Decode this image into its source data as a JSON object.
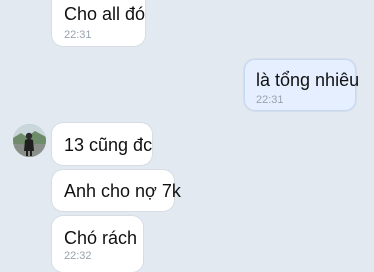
{
  "messages": [
    {
      "side": "incoming",
      "text": "Cho all đó",
      "time": "22:31"
    },
    {
      "side": "outgoing",
      "text": "là tổng nhiêu",
      "time": "22:31"
    },
    {
      "side": "incoming",
      "text": "13 cũng đc",
      "time": ""
    },
    {
      "side": "incoming",
      "text": "Anh cho nợ 7k",
      "time": ""
    },
    {
      "side": "incoming",
      "text": "Chó rách",
      "time": "22:32"
    }
  ],
  "avatar": {
    "icon": "user-avatar-photo"
  },
  "colors": {
    "background": "#e2e9f1",
    "incoming_bubble": "#ffffff",
    "outgoing_bubble": "#e5efff",
    "timestamp": "#99a2ad"
  }
}
